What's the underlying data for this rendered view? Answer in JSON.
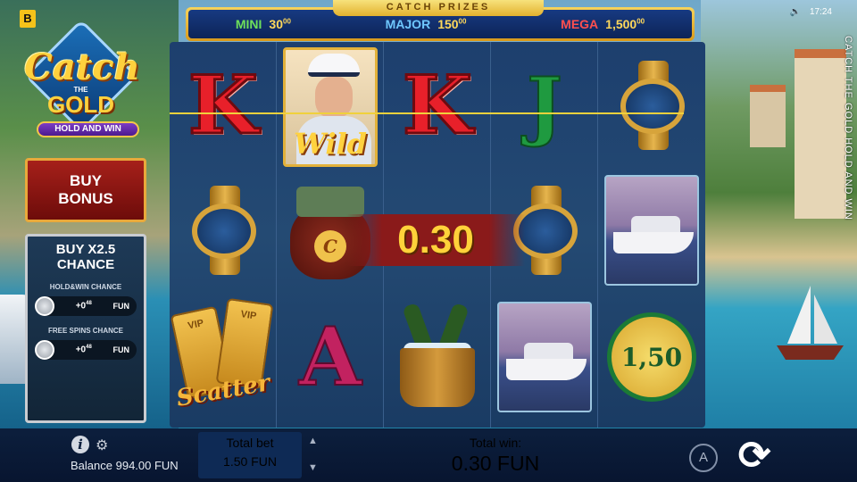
{
  "brand_badge": "B",
  "logo": {
    "catch": "Catch",
    "the": "THE",
    "gold": "GOLD",
    "hold_and_win": "HOLD AND WIN"
  },
  "jackpots": {
    "title": "CATCH PRIZES",
    "items": [
      {
        "label": "MINI",
        "value": "30",
        "cents": "00"
      },
      {
        "label": "MAJOR",
        "value": "150",
        "cents": "00"
      },
      {
        "label": "MEGA",
        "value": "1,500",
        "cents": "00"
      }
    ]
  },
  "status": {
    "time": "17:24",
    "sound_icon": "speaker-icon"
  },
  "side_text": "CATCH THE GOLD HOLD AND WIN",
  "buy_bonus": {
    "line1": "BUY",
    "line2": "BONUS"
  },
  "chance_panel": {
    "title_line1": "BUY X2.5",
    "title_line2": "CHANCE",
    "hold_win_label": "HOLD&WIN CHANCE",
    "hold_win_value": "+0",
    "hold_win_cents": "48",
    "hold_win_currency": "FUN",
    "free_spins_label": "FREE SPINS CHANCE",
    "free_spins_value": "+0",
    "free_spins_cents": "48",
    "free_spins_currency": "FUN"
  },
  "reels": {
    "symbols": {
      "r1c1": "K",
      "r1c3": "K",
      "r1c4": "J",
      "r3c2": "A",
      "wild": "Wild",
      "scatter": "Scatter",
      "vip": "VIP",
      "coin_value": "1,50",
      "moneybag_letter": "C"
    },
    "win_amount": "0.30"
  },
  "bottom": {
    "balance_label": "Balance",
    "balance_value": "994.00 FUN",
    "total_bet_label": "Total bet",
    "total_bet_value": "1.50 FUN",
    "total_win_label": "Total win:",
    "total_win_value": "0.30 FUN",
    "autoplay_label": "A",
    "info_glyph": "i"
  }
}
